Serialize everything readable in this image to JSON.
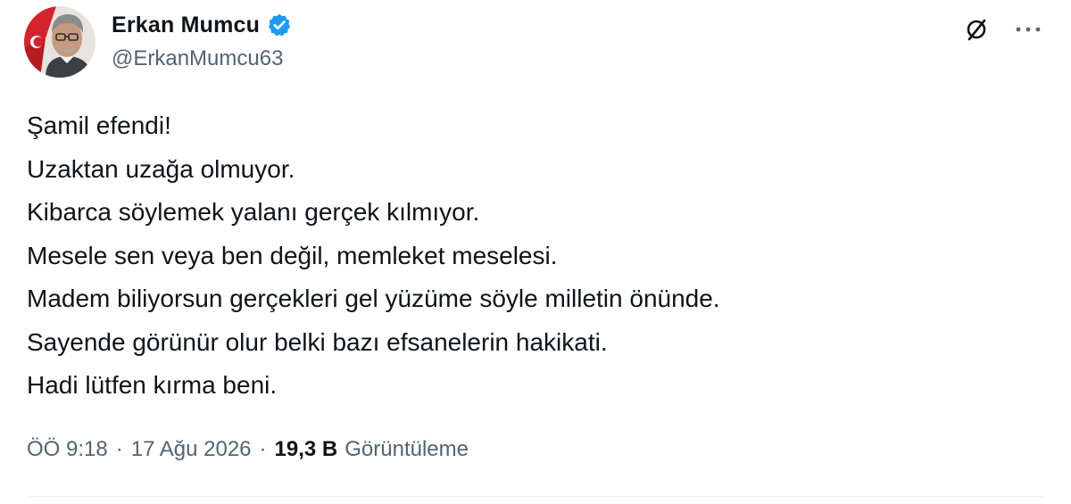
{
  "author": {
    "display_name": "Erkan Mumcu",
    "handle": "@ErkanMumcu63",
    "verified": true,
    "verified_color": "#1d9bf0"
  },
  "actions": {
    "grok_icon": "grok-icon",
    "more_icon": "more-icon",
    "more_label": "···"
  },
  "tweet": {
    "lines": [
      "Şamil efendi!",
      "Uzaktan uzağa olmuyor.",
      "Kibarca söylemek yalanı gerçek kılmıyor.",
      "Mesele sen veya ben değil, memleket meselesi.",
      "Madem biliyorsun gerçekleri gel yüzüme söyle milletin önünde.",
      "Sayende görünür olur belki bazı efsanelerin hakikati.",
      "Hadi lütfen kırma beni."
    ]
  },
  "meta": {
    "time": "ÖÖ 9:18",
    "separator": "·",
    "date": "17 Ağu 2026",
    "views_count": "19,3 B",
    "views_label": "Görüntüleme"
  },
  "colors": {
    "text_primary": "#0f1419",
    "text_secondary": "#536471",
    "divider": "#eff3f4"
  }
}
